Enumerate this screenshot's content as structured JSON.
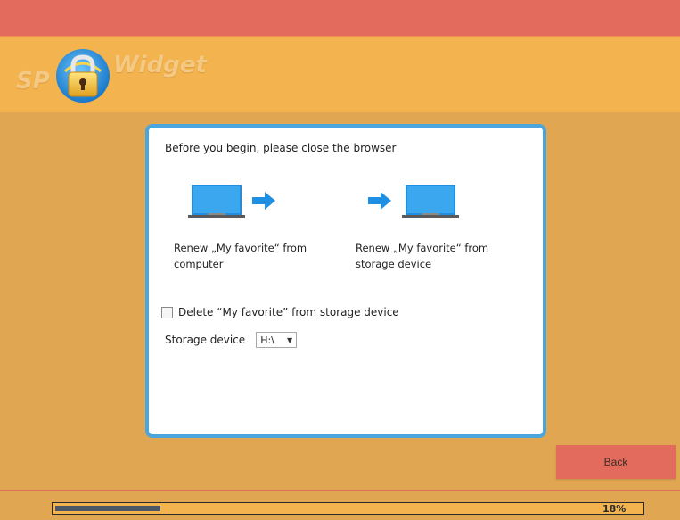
{
  "header": {
    "logo_left": "SP",
    "logo_right": "Widget",
    "logo_icon": "lock-icon"
  },
  "dialog": {
    "title": "Before you begin, please close the browser",
    "options": [
      {
        "label_line1": "Renew „My favorite“ from",
        "label_line2": "computer",
        "illustration": "computer-to-arrow"
      },
      {
        "label_line1": "Renew „My favorite“ from",
        "label_line2": "storage device",
        "illustration": "arrow-to-computer"
      }
    ],
    "checkbox": {
      "label": "Delete “My favorite” from storage device",
      "checked": false
    },
    "storage": {
      "label": "Storage device",
      "selected": "H:\\"
    }
  },
  "buttons": {
    "back": "Back"
  },
  "progress": {
    "value": 0.18,
    "text": "18%"
  },
  "colors": {
    "accent_blue": "#4aa6dd",
    "top_bar": "#e36b5d",
    "header_bg": "#f3b34e",
    "body_bg": "#e0a651",
    "progress_fill": "#4b5666"
  }
}
